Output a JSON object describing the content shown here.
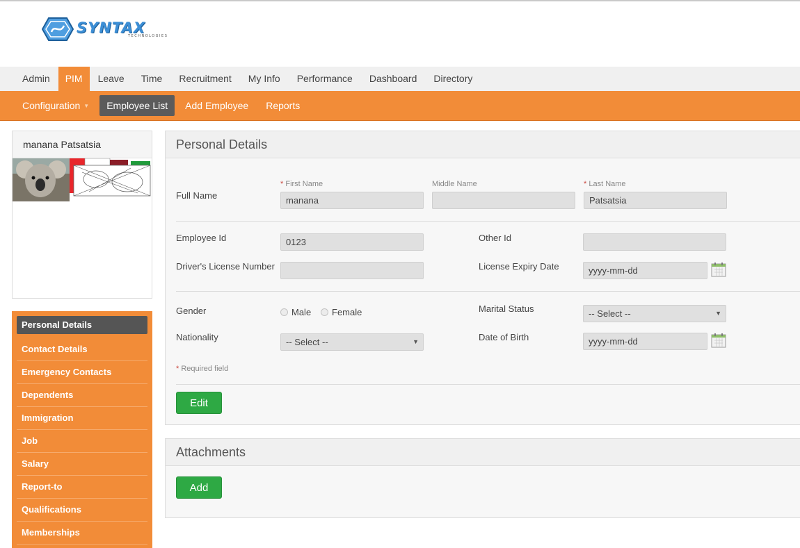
{
  "brand": {
    "logo_text": "SYNTAX",
    "logo_sub": "TECHNOLOGIES"
  },
  "main_menu": [
    "Admin",
    "PIM",
    "Leave",
    "Time",
    "Recruitment",
    "My Info",
    "Performance",
    "Dashboard",
    "Directory"
  ],
  "sub_menu": {
    "configuration": "Configuration",
    "employee_list": "Employee List",
    "add_employee": "Add Employee",
    "reports": "Reports"
  },
  "profile": {
    "name": "manana Patsatsia"
  },
  "side_menu": [
    "Personal Details",
    "Contact Details",
    "Emergency Contacts",
    "Dependents",
    "Immigration",
    "Job",
    "Salary",
    "Report-to",
    "Qualifications",
    "Memberships"
  ],
  "personal_details": {
    "title": "Personal Details",
    "full_name_label": "Full Name",
    "first_name_label": "First Name",
    "middle_name_label": "Middle Name",
    "last_name_label": "Last Name",
    "required_mark": "*",
    "first_name": "manana",
    "middle_name": "",
    "last_name": "Patsatsia",
    "employee_id_label": "Employee Id",
    "employee_id": "0123",
    "other_id_label": "Other Id",
    "other_id": "",
    "license_label": "Driver's License Number",
    "license": "",
    "license_expiry_label": "License Expiry Date",
    "license_expiry_placeholder": "yyyy-mm-dd",
    "gender_label": "Gender",
    "gender_male": "Male",
    "gender_female": "Female",
    "marital_label": "Marital Status",
    "marital_value": "-- Select --",
    "nationality_label": "Nationality",
    "nationality_value": "-- Select --",
    "dob_label": "Date of Birth",
    "dob_placeholder": "yyyy-mm-dd",
    "required_note": "Required field",
    "edit_button": "Edit"
  },
  "attachments": {
    "title": "Attachments",
    "add_button": "Add"
  },
  "colors": {
    "accent_orange": "#f28c38",
    "active_dark": "#555555",
    "button_green": "#2ea944"
  }
}
